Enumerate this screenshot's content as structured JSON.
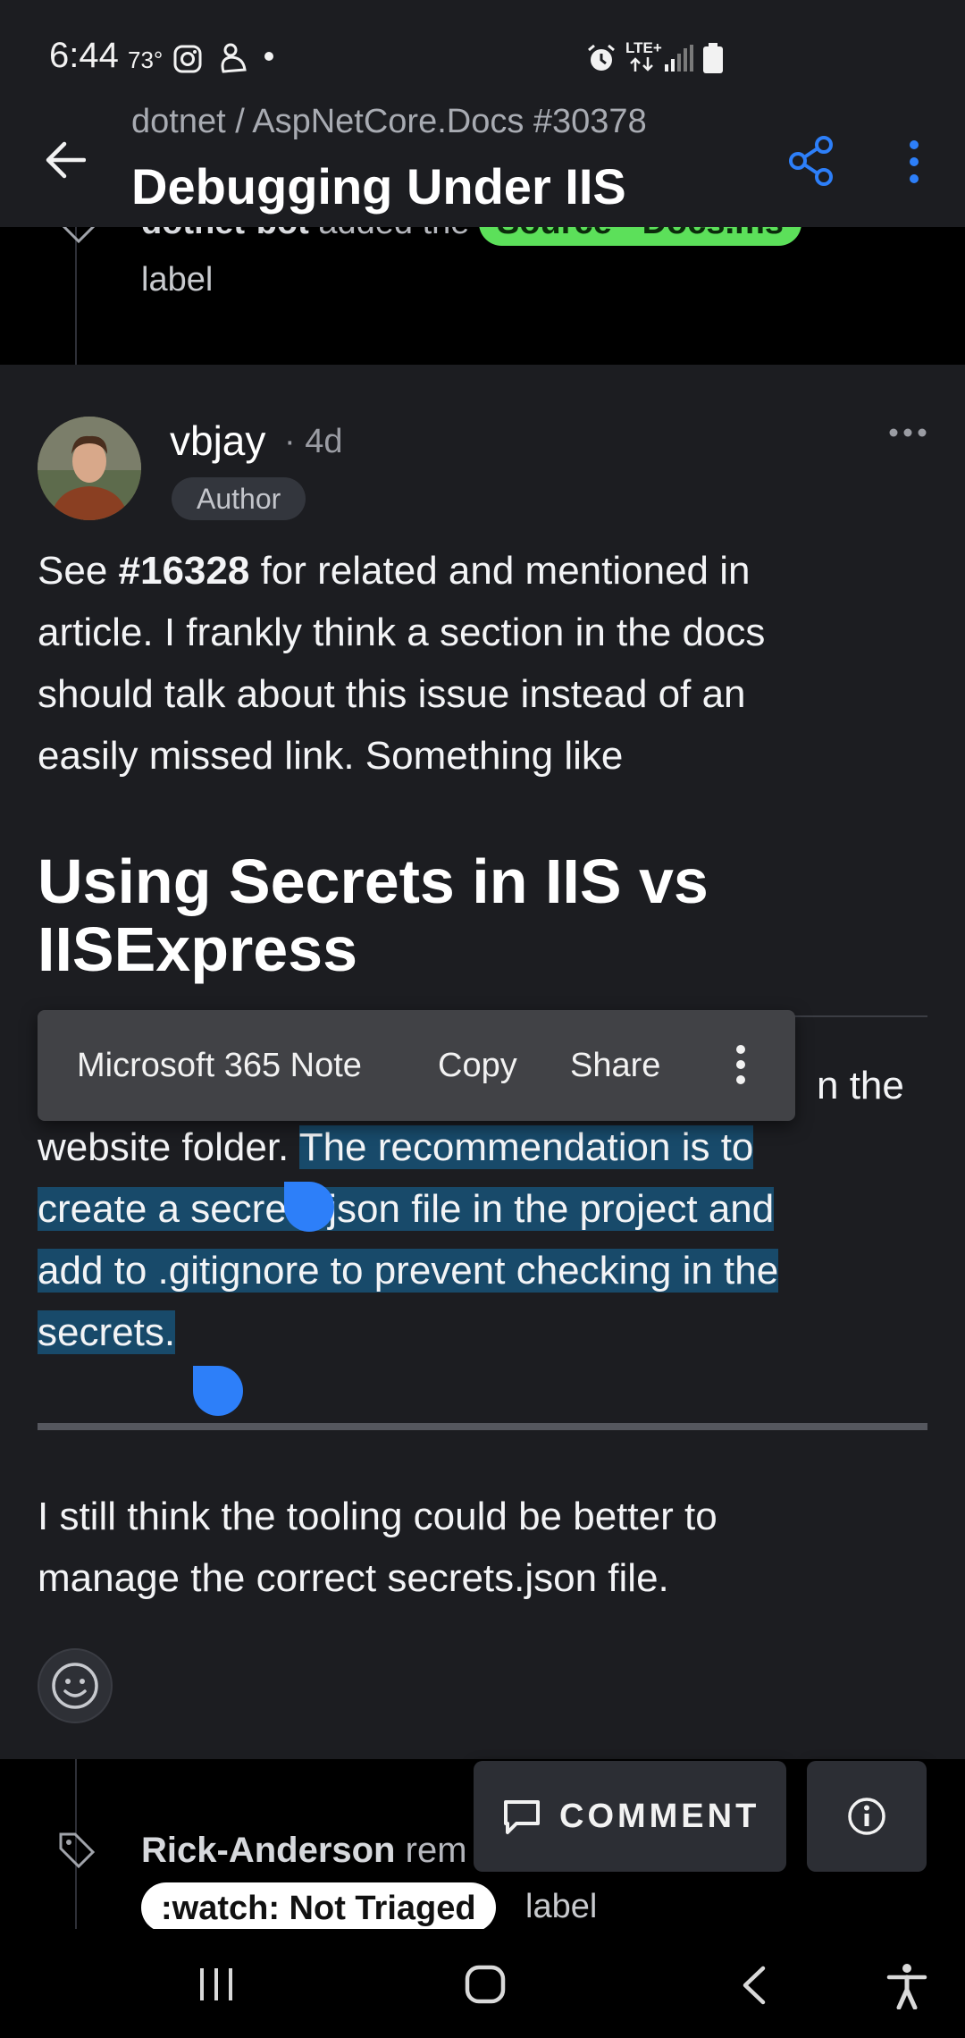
{
  "status_bar": {
    "time": "6:44",
    "temperature": "73°",
    "network": "LTE+"
  },
  "header": {
    "repo_path": "dotnet / AspNetCore.Docs #30378",
    "title": "Debugging Under IIS",
    "back_icon": "arrow-left-icon",
    "share_icon": "share-icon",
    "menu_icon": "more-vert-icon"
  },
  "timeline_above": {
    "actor": "dotnet-bot",
    "action": "added the",
    "chip_label": "Source - Docs.ms",
    "trailing": "label"
  },
  "comment": {
    "username": "vbjay",
    "age": "· 4d",
    "badge": "Author",
    "paragraph1": {
      "prefix": "See ",
      "link": "#16328",
      "line1_rest": " for related and mentioned in",
      "line2": "article. I frankly think a section in the docs",
      "line3": "should talk about this issue instead of an",
      "line4": "easily missed link. Something like"
    },
    "heading_line1": "Using Secrets in IIS vs",
    "heading_line2": "IISExpress",
    "paragraph2": {
      "line1_visible": "n the",
      "line2_plain": "website folder. ",
      "line2_selected": "The recommendation is to",
      "line3": "create a secrets.json file in the project and",
      "line4": "add to .gitignore to prevent checking in the",
      "line5": "secrets."
    },
    "paragraph3": {
      "line1": "I still think the tooling could be better to",
      "line2": "manage the correct secrets.json file."
    }
  },
  "context_menu": {
    "items": [
      "Microsoft 365 Note",
      "Copy",
      "Share"
    ],
    "overflow_icon": "more-vert-icon"
  },
  "timeline_below": {
    "actor": "Rick-Anderson",
    "action": "rem",
    "chip_label": ":watch: Not Triaged",
    "trailing": "label"
  },
  "actions": {
    "comment_label": "COMMENT",
    "info_icon": "info-icon"
  },
  "colors": {
    "background": "#1c1d21",
    "accent": "#2d7ff9",
    "selection": "#184a6a",
    "green_label": "#5ce05a"
  }
}
